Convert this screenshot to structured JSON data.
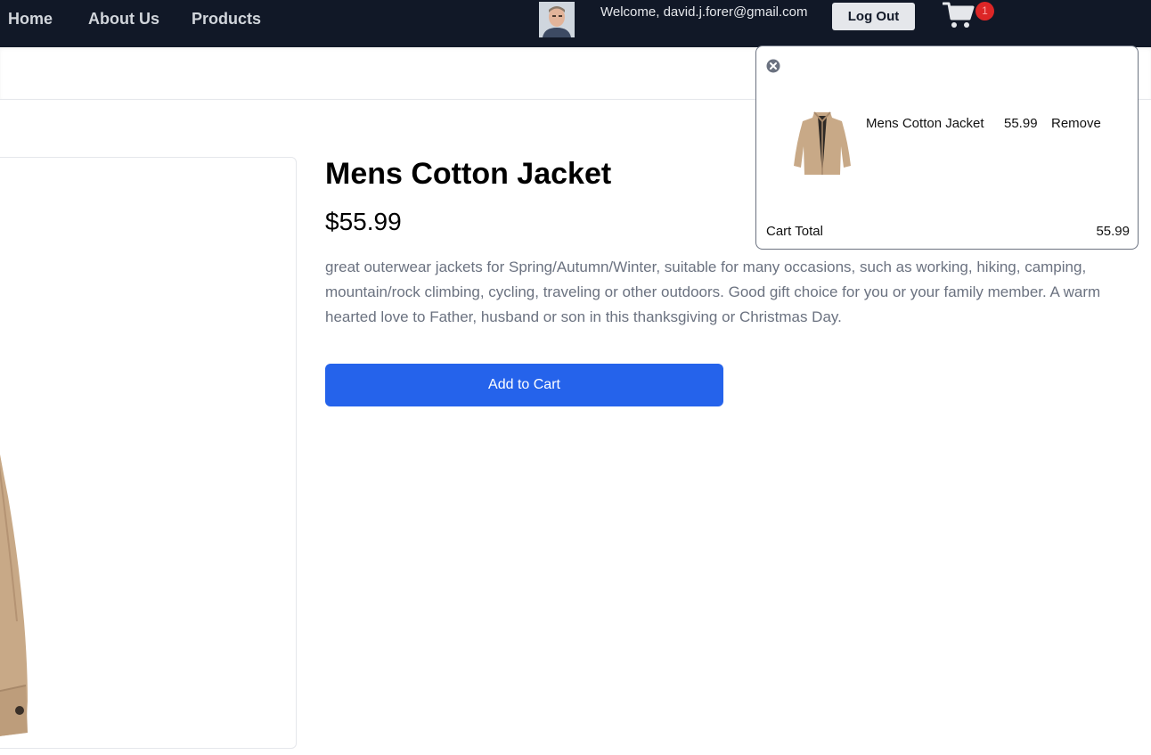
{
  "nav": {
    "home": "Home",
    "about": "About Us",
    "products": "Products"
  },
  "user": {
    "welcome": "Welcome, david.j.forer@gmail.com",
    "logout_label": "Log Out",
    "avatar_icon": "user-avatar-photo"
  },
  "cart": {
    "icon": "shopping-cart-icon",
    "badge_count": "1",
    "close_icon": "close-circle-icon",
    "items": [
      {
        "name": "Mens Cotton Jacket",
        "price": "55.99",
        "remove_label": "Remove"
      }
    ],
    "total_label": "Cart Total",
    "total_value": "55.99"
  },
  "product": {
    "title": "Mens Cotton Jacket",
    "price": "$55.99",
    "description": "great outerwear jackets for Spring/Autumn/Winter, suitable for many occasions, such as working, hiking, camping, mountain/rock climbing, cycling, traveling or other outdoors. Good gift choice for you or your family member. A warm hearted love to Father, husband or son in this thanksgiving or Christmas Day.",
    "add_to_cart_label": "Add to Cart"
  },
  "colors": {
    "nav_bg": "#111827",
    "primary_button": "#2563eb",
    "badge": "#dc2626",
    "jacket": "#c8a987"
  }
}
